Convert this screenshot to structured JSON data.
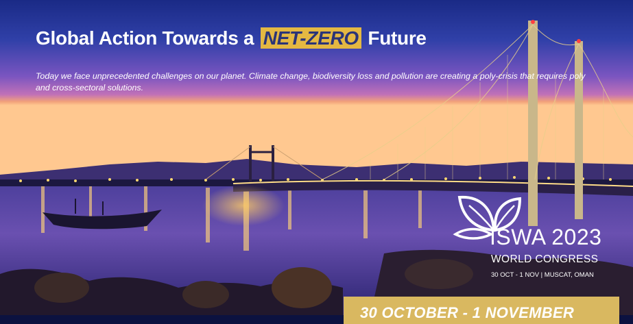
{
  "hero": {
    "headline_pre": "Global Action Towards a",
    "headline_highlight": "NET-ZERO",
    "headline_post": "Future",
    "lead": "Today we face unprecedented challenges on our planet. Climate change, biodiversity loss and pollution are creating a poly-crisis that requires poly and cross-sectoral solutions."
  },
  "brand": {
    "name": "ISWA 2023",
    "subtitle": "WORLD CONGRESS",
    "meta": "30 OCT - 1 NOV | MUSCAT, OMAN",
    "logo_icon": "leaf-logo-icon"
  },
  "banner": {
    "text": "30 OCTOBER - 1 NOVEMBER"
  },
  "colors": {
    "highlight": "#e4b842",
    "banner": "#d9b860",
    "sky_top": "#1b2a8a",
    "sky_horizon": "#f0a070"
  }
}
